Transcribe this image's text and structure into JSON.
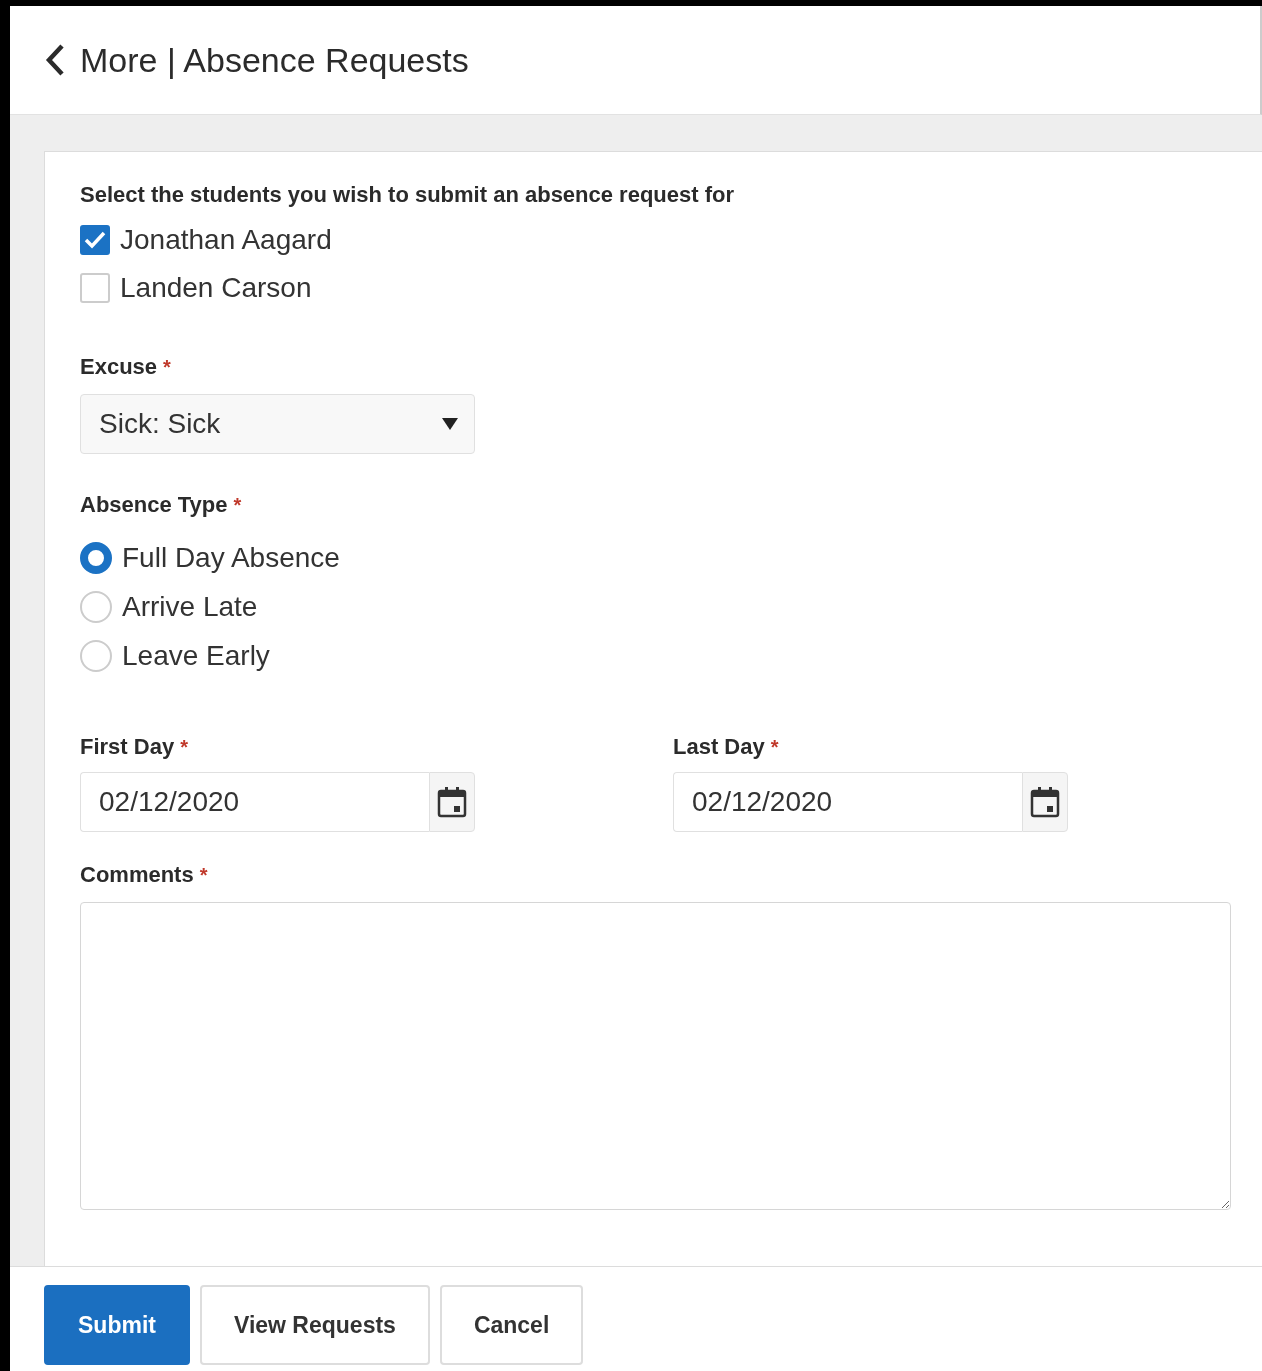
{
  "header": {
    "title": "More | Absence Requests"
  },
  "students": {
    "label": "Select the students you wish to submit an absence request for",
    "items": [
      {
        "name": "Jonathan Aagard",
        "checked": true
      },
      {
        "name": "Landen Carson",
        "checked": false
      }
    ]
  },
  "excuse": {
    "label": "Excuse",
    "required_mark": "*",
    "value": "Sick: Sick"
  },
  "absence_type": {
    "label": "Absence Type",
    "required_mark": "*",
    "options": [
      {
        "label": "Full Day Absence",
        "selected": true
      },
      {
        "label": "Arrive Late",
        "selected": false
      },
      {
        "label": "Leave Early",
        "selected": false
      }
    ]
  },
  "first_day": {
    "label": "First Day",
    "required_mark": "*",
    "value": "02/12/2020"
  },
  "last_day": {
    "label": "Last Day",
    "required_mark": "*",
    "value": "02/12/2020"
  },
  "comments": {
    "label": "Comments",
    "required_mark": "*"
  },
  "buttons": [
    {
      "label": "Submit",
      "kind": "primary"
    },
    {
      "label": "View Requests",
      "kind": "secondary"
    },
    {
      "label": "Cancel",
      "kind": "secondary"
    }
  ]
}
